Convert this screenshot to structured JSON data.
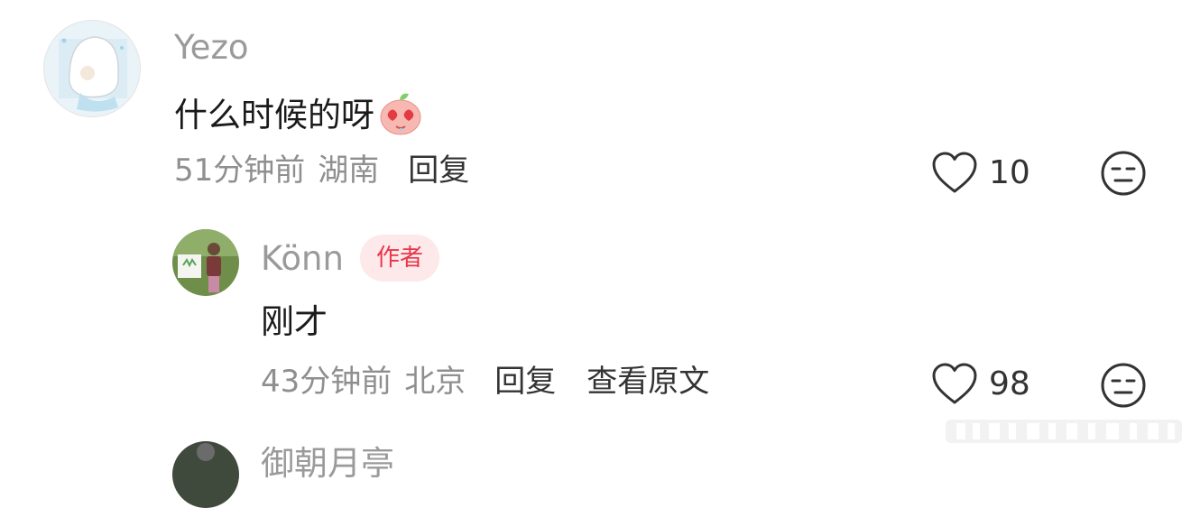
{
  "comments": [
    {
      "username": "Yezo",
      "text": "什么时候的呀",
      "emoji": "heart-eyes-peach-emoji",
      "time": "51分钟前",
      "location": "湖南",
      "reply_label": "回复",
      "like_count": "10"
    },
    {
      "username": "Könn",
      "badge": "作者",
      "text": "刚才",
      "time": "43分钟前",
      "location": "北京",
      "reply_label": "回复",
      "view_original_label": "查看原文",
      "like_count": "98"
    }
  ],
  "next_comment": {
    "username_partial": "御朝月亭"
  },
  "icons": {
    "like": "heart-outline-icon",
    "dislike": "unamused-face-icon"
  },
  "colors": {
    "badge_text": "#e8364a",
    "badge_bg": "#fde8ea",
    "meta": "#8f8f8f",
    "username": "#9a9a9a"
  }
}
